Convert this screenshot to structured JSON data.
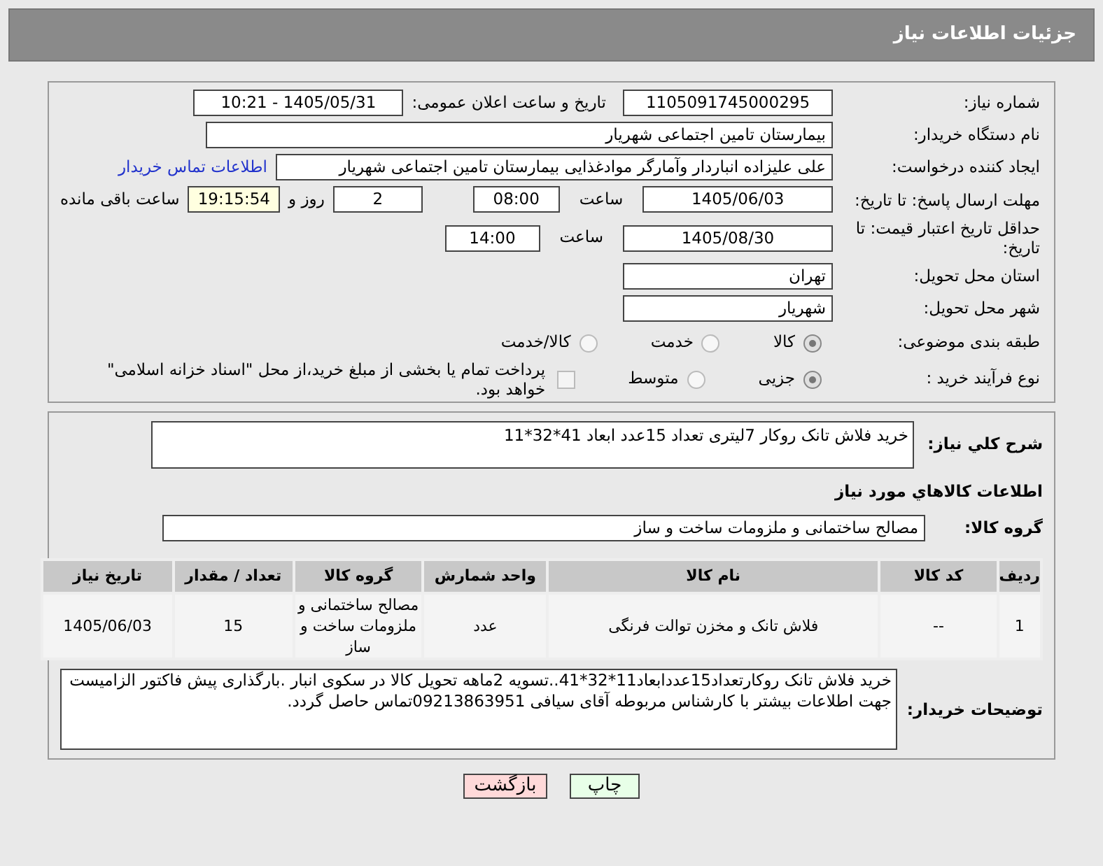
{
  "header": {
    "title": "جزئیات اطلاعات نیاز"
  },
  "need_number": {
    "label": "شماره نیاز:",
    "value": "1105091745000295"
  },
  "announce": {
    "label": "تاریخ و ساعت اعلان عمومی:",
    "value": "1405/05/31 - 10:21"
  },
  "buyer_org": {
    "label": "نام دستگاه خریدار:",
    "value": "بیمارستان تامین اجتماعی شهریار"
  },
  "requester": {
    "label": "ایجاد کننده درخواست:",
    "value": "علی علیزاده انباردار وآمارگر موادغذایی بیمارستان تامین اجتماعی شهریار",
    "link": "اطلاعات تماس خریدار"
  },
  "deadline": {
    "label": "مهلت ارسال پاسخ: تا تاریخ:",
    "date": "1405/06/03",
    "time_label": "ساعت",
    "time": "08:00",
    "days": "2",
    "days_label": "روز و",
    "remaining": "19:15:54",
    "remaining_label": "ساعت باقی مانده"
  },
  "validity": {
    "label": "حداقل تاریخ اعتبار قیمت: تا تاریخ:",
    "date": "1405/08/30",
    "time_label": "ساعت",
    "time": "14:00"
  },
  "province": {
    "label": "استان محل تحویل:",
    "value": "تهران"
  },
  "city": {
    "label": "شهر محل تحویل:",
    "value": "شهریار"
  },
  "category": {
    "label": "طبقه بندی موضوعی:",
    "options": [
      {
        "label": "کالا",
        "selected": true
      },
      {
        "label": "خدمت",
        "selected": false
      },
      {
        "label": "کالا/خدمت",
        "selected": false
      }
    ]
  },
  "process": {
    "label": "نوع فرآیند خرید :",
    "options": [
      {
        "label": "جزیی",
        "selected": true
      },
      {
        "label": "متوسط",
        "selected": false
      }
    ],
    "treasury": {
      "label": "پرداخت تمام یا بخشی از مبلغ خرید،از محل \"اسناد خزانه اسلامی\" خواهد بود.",
      "checked": false
    }
  },
  "description": {
    "label": "شرح کلي نياز:",
    "value": "خرید فلاش تانک روکار 7لیتری  تعداد 15عدد ابعاد 41*32*11"
  },
  "goods_title": "اطلاعات کالاهاي مورد نياز",
  "goods_group": {
    "label": "گروه کالا:",
    "value": "مصالح ساختمانی و ملزومات ساخت و ساز"
  },
  "table": {
    "columns": [
      "ردیف",
      "کد کالا",
      "نام کالا",
      "واحد شمارش",
      "گروه کالا",
      "تعداد / مقدار",
      "تاریخ نیاز"
    ],
    "rows": [
      [
        "1",
        "--",
        "فلاش تانک و مخزن توالت فرنگی",
        "عدد",
        "مصالح ساختمانی و ملزومات ساخت و ساز",
        "15",
        "1405/06/03"
      ]
    ]
  },
  "buyer_notes": {
    "label": "توضیحات خریدار:",
    "value": "خرید فلاش تانک روکارتعداد15عددابعاد11*32*41..تسویه 2ماهه تحویل کالا در سکوی انبار .بارگذاری پیش فاکتور الزامیست جهت اطلاعات بیشتر با کارشناس مربوطه آقای سیافی 09213863951تماس حاصل گردد."
  },
  "buttons": [
    {
      "label": "چاپ",
      "kind": "print"
    },
    {
      "label": "بازگشت",
      "kind": "back"
    }
  ]
}
